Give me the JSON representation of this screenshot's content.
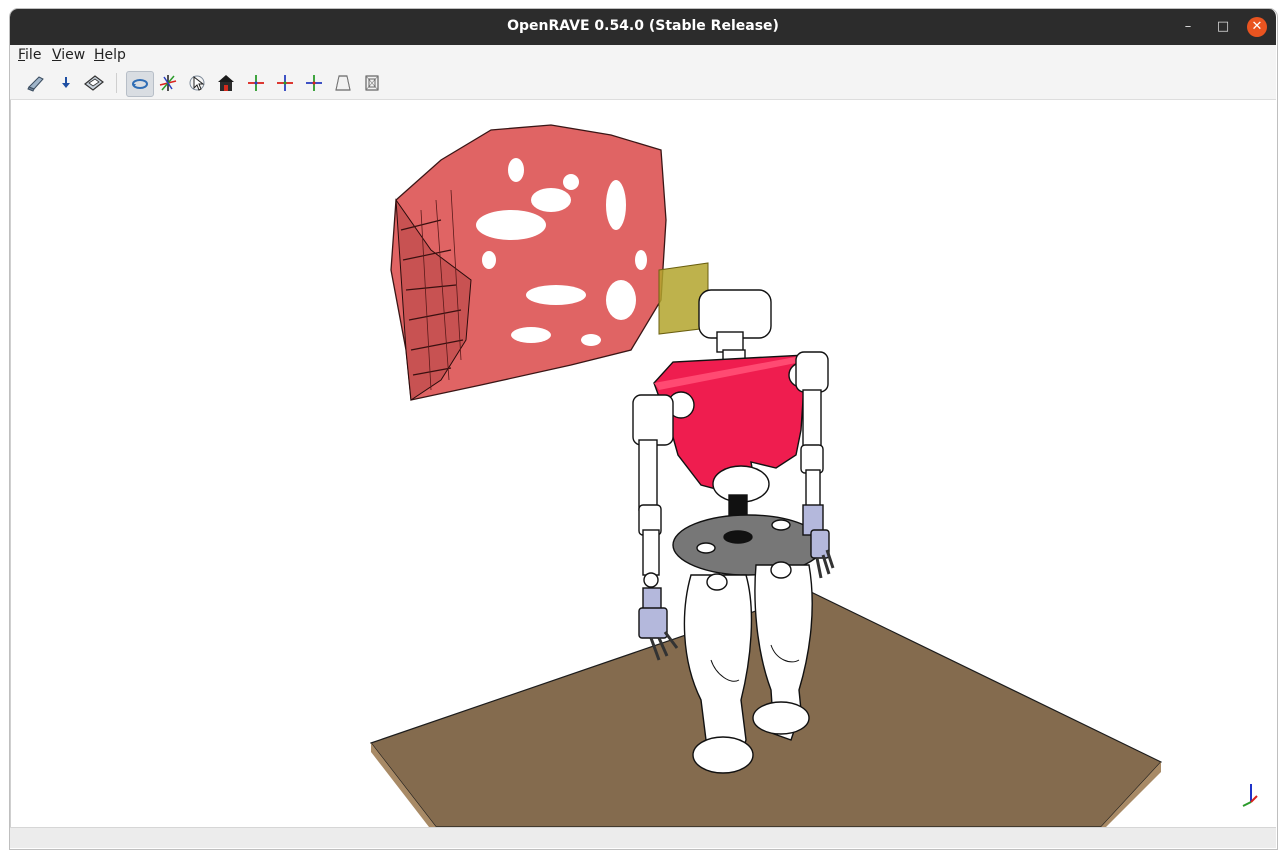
{
  "window": {
    "title": "OpenRAVE 0.54.0 (Stable Release)",
    "minimize_glyph": "–",
    "maximize_glyph": "□",
    "close_glyph": "✕"
  },
  "menu": {
    "items": [
      {
        "label": "File"
      },
      {
        "label": "View"
      },
      {
        "label": "Help"
      }
    ]
  },
  "toolbar": {
    "buttons": [
      {
        "icon": "open-file-icon",
        "active": false
      },
      {
        "icon": "download-arrow-icon",
        "active": false
      },
      {
        "icon": "save-icon",
        "active": false
      },
      {
        "icon": "rotate-camera-icon",
        "active": true
      },
      {
        "icon": "pan-axes-icon",
        "active": false
      },
      {
        "icon": "pick-cursor-icon",
        "active": false
      },
      {
        "icon": "home-view-icon",
        "active": false
      },
      {
        "icon": "view-x-axis-icon",
        "active": false
      },
      {
        "icon": "view-y-axis-icon",
        "active": false
      },
      {
        "icon": "view-z-axis-icon",
        "active": false
      },
      {
        "icon": "perspective-icon",
        "active": false
      },
      {
        "icon": "orthographic-icon",
        "active": false
      }
    ]
  },
  "scene": {
    "floor_color": "#846b4e",
    "pointcloud_color": "#e06464",
    "torso_color": "#ef1d4f",
    "sensor_plate_color": "#b3a52d",
    "hand_color": "#b4b8dc",
    "axis_indicator": "xyz-axes-icon"
  },
  "status": {
    "text": ""
  }
}
